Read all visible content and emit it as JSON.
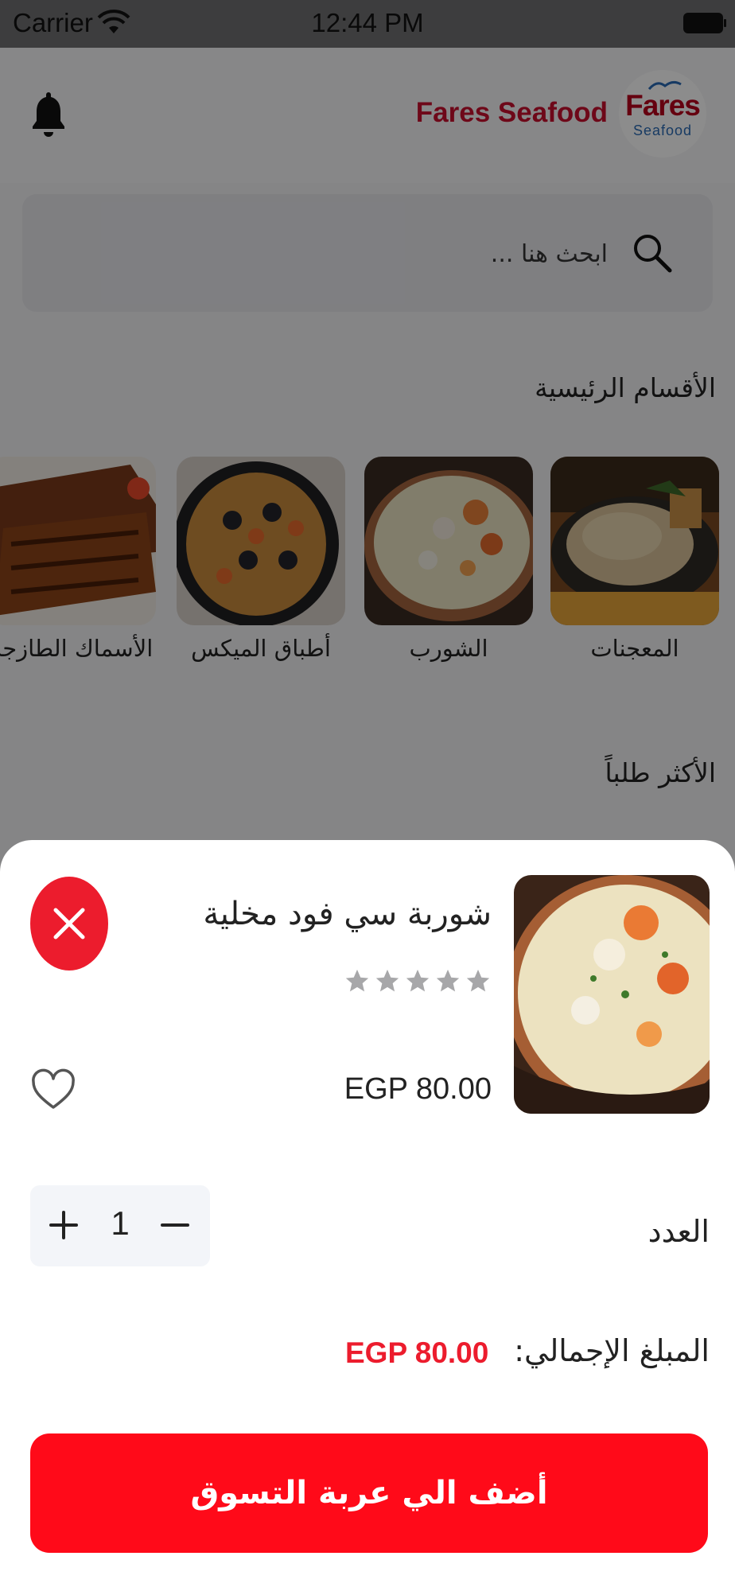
{
  "status_bar": {
    "carrier": "Carrier",
    "time": "12:44 PM"
  },
  "header": {
    "brand_name": "Fares Seafood",
    "logo_line1": "Fares",
    "logo_line2": "Seafood",
    "brand_color": "#c8102e"
  },
  "search": {
    "placeholder": "ابحث هنا ..."
  },
  "categories": {
    "title": "الأقسام الرئيسية",
    "items": [
      {
        "label": "المعجنات"
      },
      {
        "label": "الشورب"
      },
      {
        "label": "أطباق الميكس"
      },
      {
        "label": "الأسماك الطازجة"
      }
    ]
  },
  "most_ordered": {
    "title": "الأكثر طلباً"
  },
  "product_sheet": {
    "name": "شوربة سي فود مخلية",
    "rating": 0,
    "max_rating": 5,
    "price": "EGP 80.00",
    "quantity_label": "العدد",
    "quantity": "1",
    "total_label": "المبلغ الإجمالي:",
    "total_value": "EGP 80.00",
    "add_to_cart_label": "أضف الي عربة التسوق",
    "accent_color": "#ec1c2d"
  }
}
